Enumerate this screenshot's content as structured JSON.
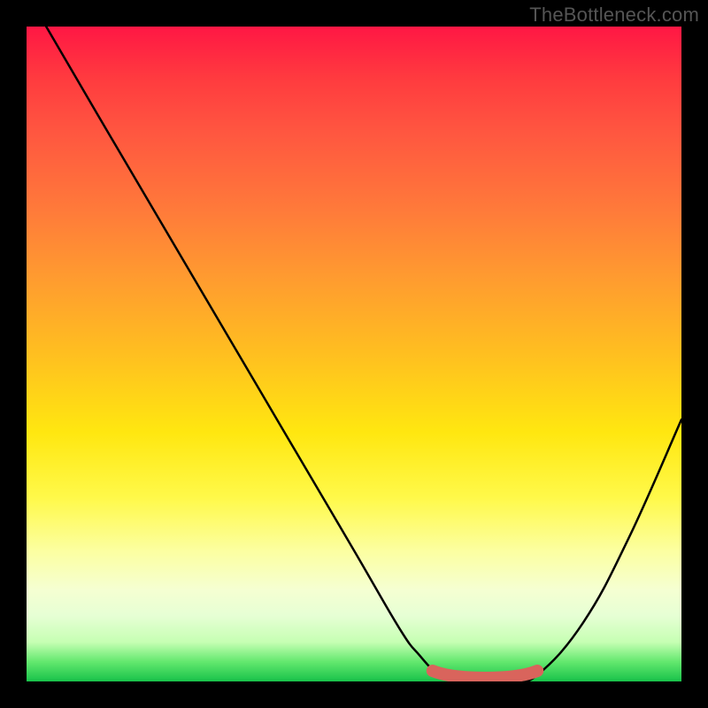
{
  "watermark": "TheBottleneck.com",
  "colors": {
    "background": "#000000",
    "curve": "#000000",
    "marker": "#d9645c"
  },
  "chart_data": {
    "type": "line",
    "title": "",
    "xlabel": "",
    "ylabel": "",
    "xlim": [
      0,
      100
    ],
    "ylim": [
      0,
      100
    ],
    "grid": false,
    "legend": false,
    "series": [
      {
        "name": "bottleneck-curve",
        "x": [
          3,
          10,
          20,
          30,
          40,
          50,
          57,
          60,
          63,
          66,
          70,
          74,
          78,
          85,
          92,
          100
        ],
        "y": [
          100,
          88,
          71,
          54,
          37,
          20,
          8,
          4,
          1,
          0,
          0,
          0,
          1,
          9,
          22,
          40
        ]
      }
    ],
    "highlight_region": {
      "name": "optimum-range",
      "x_start": 62,
      "x_end": 78,
      "y": 0
    },
    "gradient_background": {
      "direction": "top-to-bottom",
      "stops": [
        {
          "pos": 0.0,
          "color": "#ff1744"
        },
        {
          "pos": 0.28,
          "color": "#ff7a3a"
        },
        {
          "pos": 0.5,
          "color": "#ffbf20"
        },
        {
          "pos": 0.72,
          "color": "#fff94a"
        },
        {
          "pos": 0.9,
          "color": "#e6ffd4"
        },
        {
          "pos": 1.0,
          "color": "#18c24a"
        }
      ]
    }
  }
}
